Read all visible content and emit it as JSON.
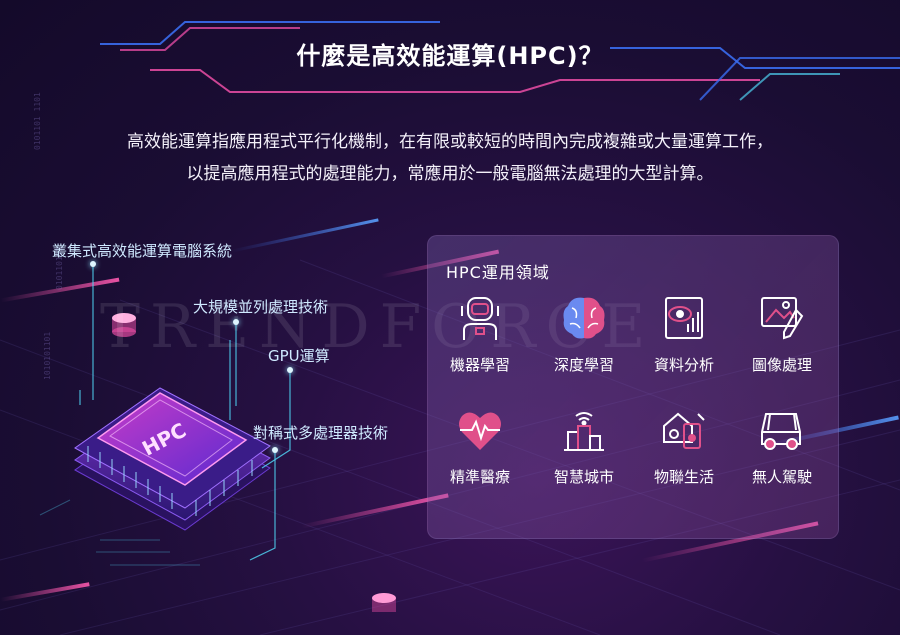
{
  "title": "什麼是高效能運算(HPC)？",
  "intro": {
    "line1": "高效能運算指應用程式平行化機制，在有限或較短的時間內完成複雜或大量運算工作，",
    "line2": "以提高應用程式的處理能力，常應用於一般電腦無法處理的大型計算。"
  },
  "watermark": "TRENDFORCE",
  "chip": {
    "label": "HPC",
    "callouts": [
      "叢集式高效能運算電腦系統",
      "大規模並列處理技術",
      "GPU運算",
      "對稱式多處理器技術"
    ]
  },
  "applications": {
    "heading": "HPC運用領域",
    "items": [
      {
        "label": "機器學習",
        "icon": "robot-icon"
      },
      {
        "label": "深度學習",
        "icon": "brain-icon"
      },
      {
        "label": "資料分析",
        "icon": "data-analysis-icon"
      },
      {
        "label": "圖像處理",
        "icon": "image-processing-icon"
      },
      {
        "label": "精準醫療",
        "icon": "heart-pulse-icon"
      },
      {
        "label": "智慧城市",
        "icon": "smart-city-icon"
      },
      {
        "label": "物聯生活",
        "icon": "iot-icon"
      },
      {
        "label": "無人駕駛",
        "icon": "autonomous-car-icon"
      }
    ]
  },
  "colors": {
    "accent_cyan": "#4fd0f0",
    "accent_blue": "#3a6df0",
    "accent_pink": "#e04aa0",
    "icon_white": "#ffffff",
    "icon_pink": "#e0508a"
  }
}
